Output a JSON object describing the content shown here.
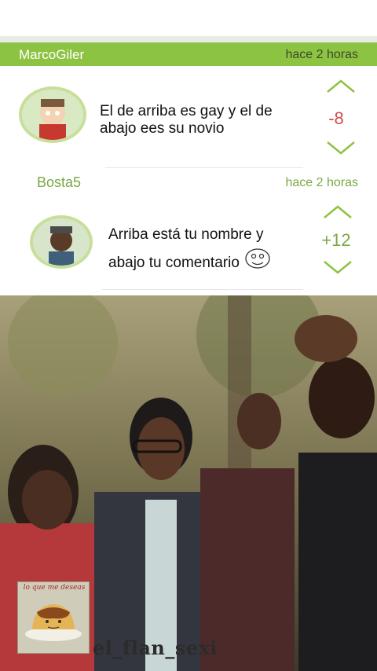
{
  "comments": [
    {
      "username": "MarcoGiler",
      "time": "hace 2 horas",
      "text_line1": "El de arriba es gay y el de",
      "text_line2": "abajo ees su novio",
      "score": "-8",
      "score_color": "#d24b4b"
    },
    {
      "username": "Bosta5",
      "time": "hace 2 horas",
      "text_line1": "Arriba está tu nombre y",
      "text_line2": "abajo tu comentario",
      "score": "+12",
      "score_color": "#7ba744"
    }
  ],
  "watermark": {
    "caption": "lo que me deseas",
    "name": "el_flan_sexi"
  },
  "colors": {
    "accent": "#8dc342",
    "header_text_dark": "#3d4a2a"
  },
  "icons": [
    "up-arrow-icon",
    "down-arrow-icon",
    "troll-face-icon"
  ]
}
